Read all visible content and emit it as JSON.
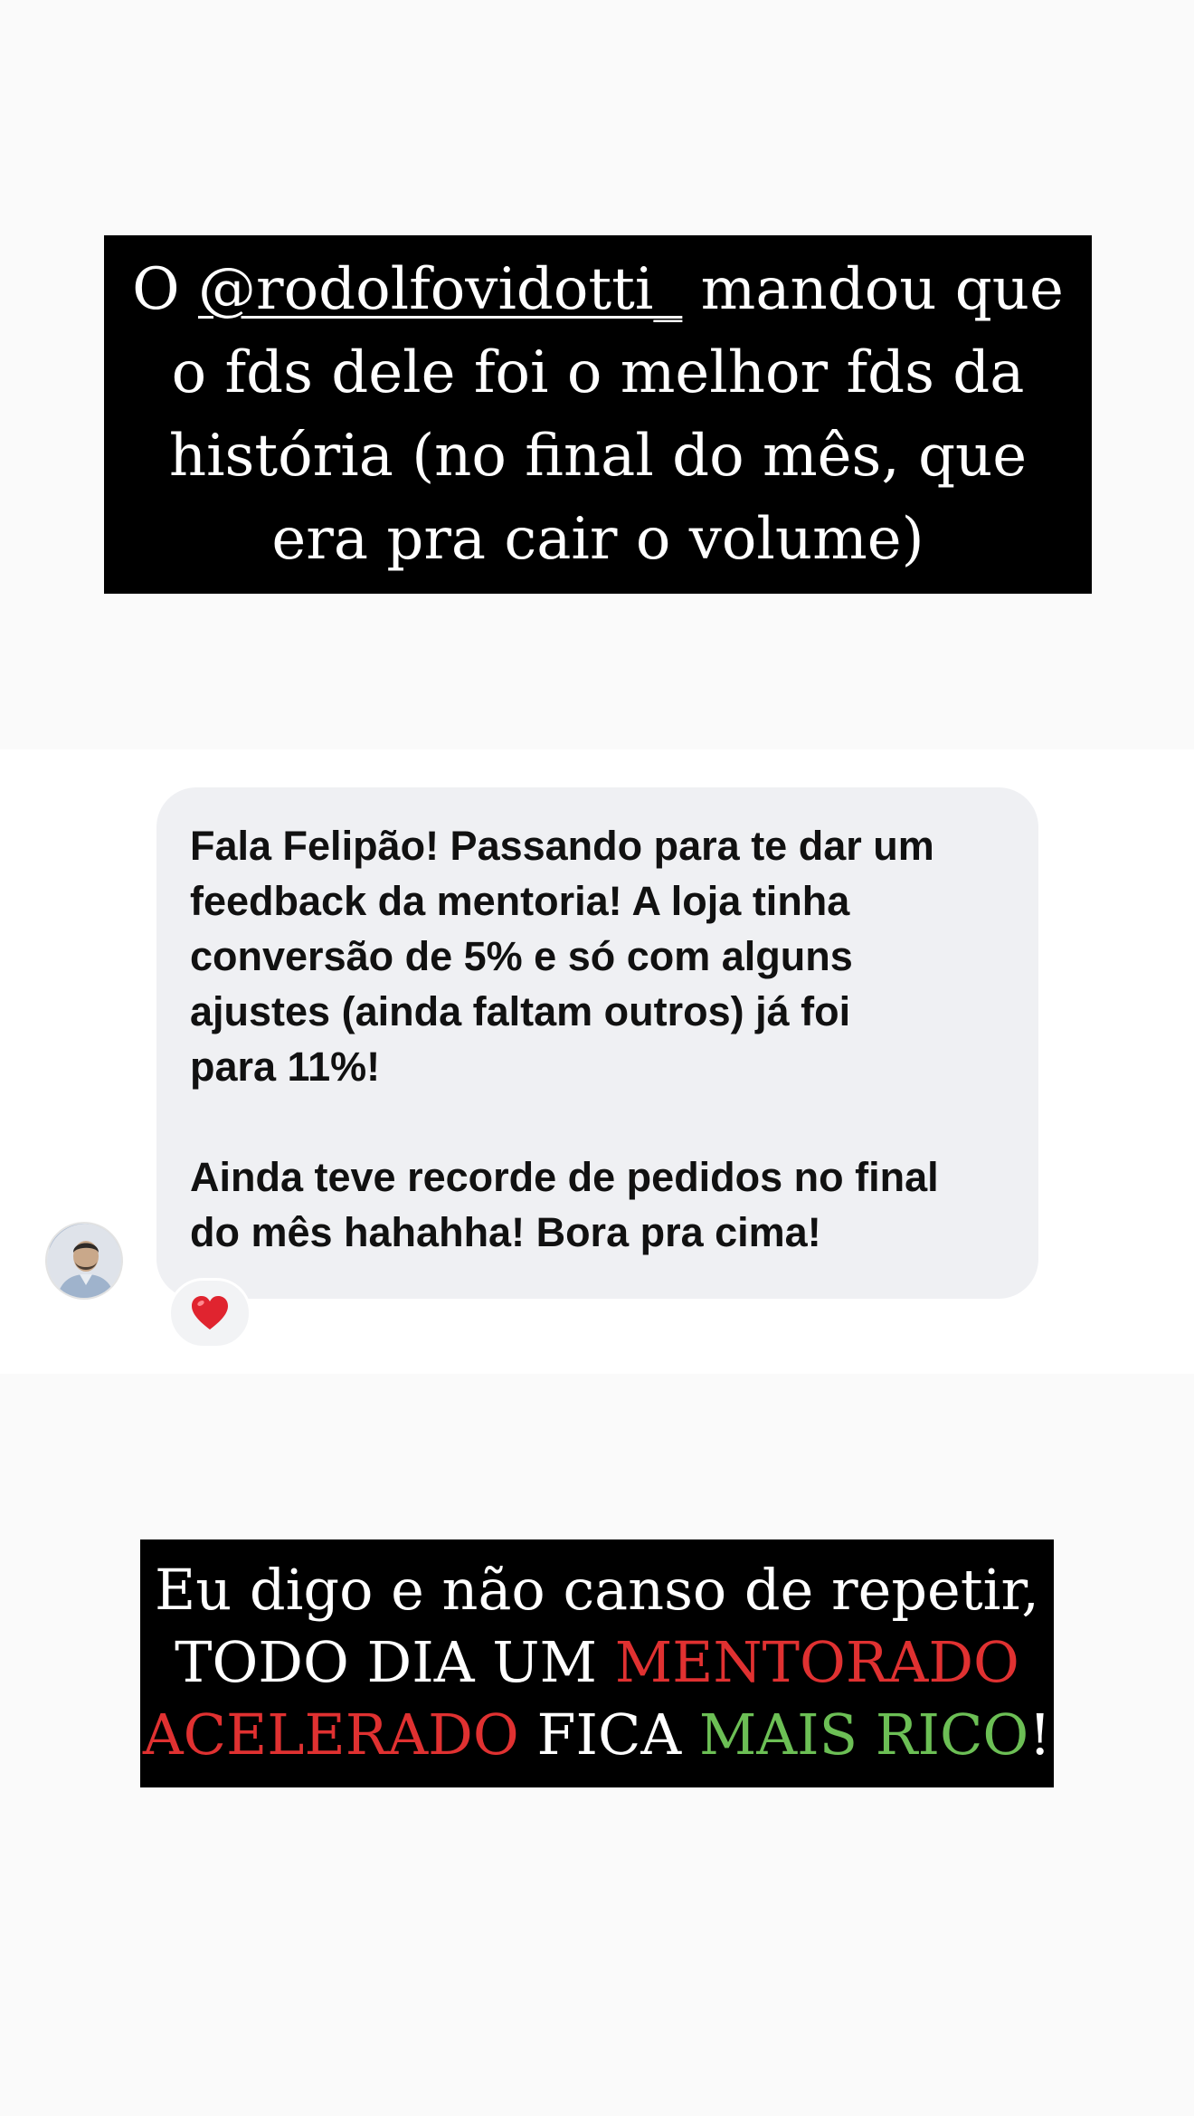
{
  "story": {
    "top_caption": {
      "prefix": "O ",
      "mention": "@rodolfovidotti_",
      "line1_suffix": " mandou que",
      "line2": "o fds dele foi o melhor fds da",
      "line3": "história (no final do mês, que",
      "line4": "era pra cair o volume)"
    },
    "message": {
      "text": "Fala Felipão! Passando para te dar um\nfeedback da mentoria! A loja tinha\nconversão de 5% e só com alguns\najustes (ainda faltam outros) já foi\npara 11%!\n\nAinda teve recorde de pedidos no final\ndo mês hahahha! Bora pra cima!",
      "reaction_icon": "red-heart-icon"
    },
    "bottom_caption": {
      "line1": "Eu digo e não canso de repetir,",
      "line2_white": "TODO DIA UM ",
      "line2_red": "MENTORADO",
      "line3_red": "ACELERADO",
      "line3_white": " FICA ",
      "line3_green": "MAIS RICO",
      "line3_end": "!"
    },
    "colors": {
      "caption_bg": "#000000",
      "accent_red": "#e03131",
      "accent_green": "#6cbf55",
      "bubble_bg": "#eff0f3",
      "heart": "#e0242f"
    }
  }
}
